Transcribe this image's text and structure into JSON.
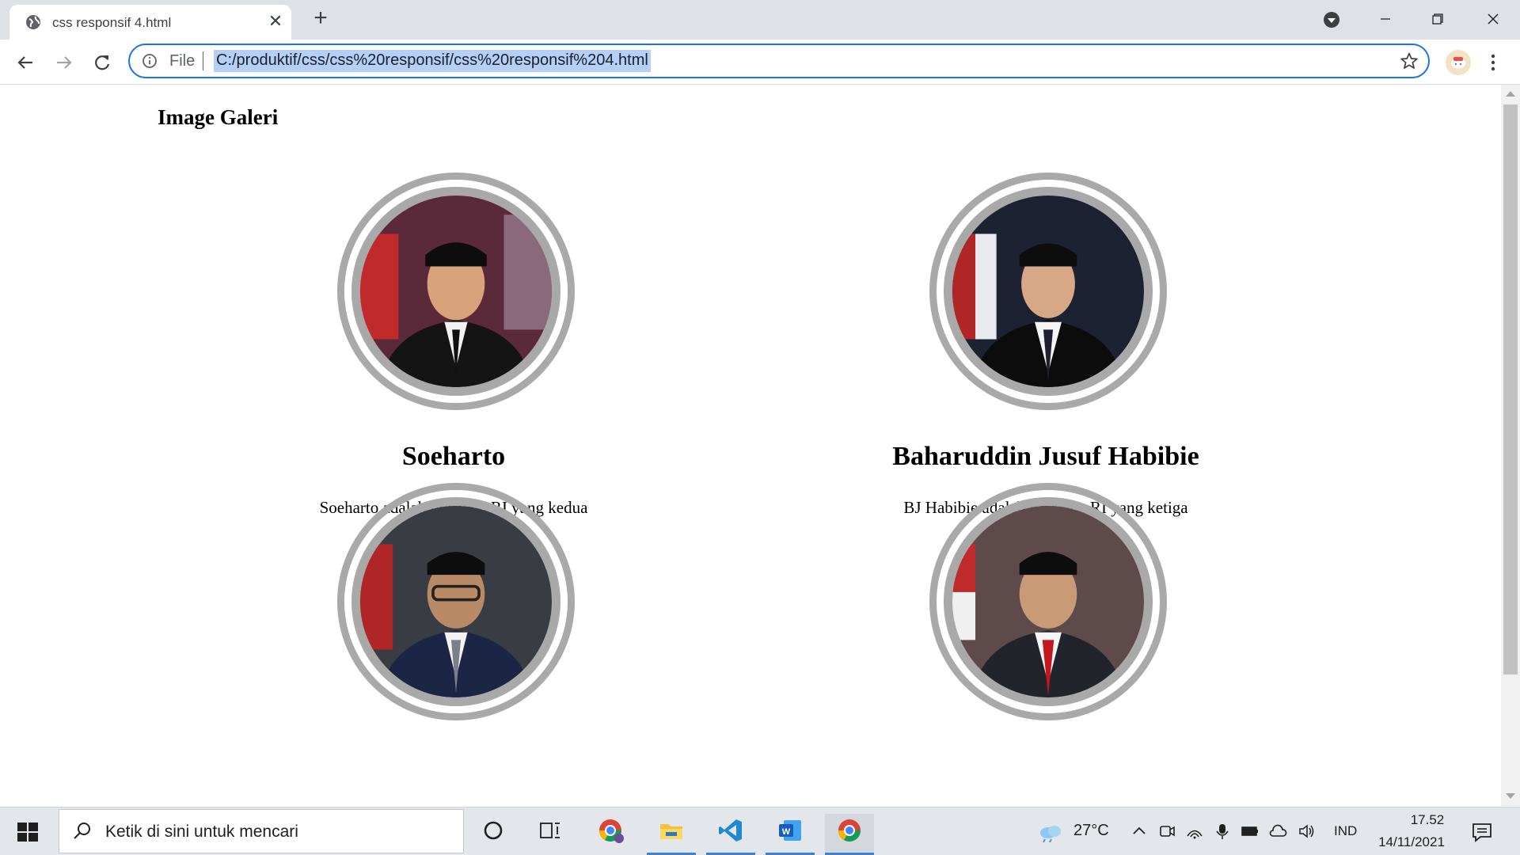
{
  "browser": {
    "tab_title": "css responsif 4.html",
    "address_scheme": "File",
    "address_url": "C:/produktif/css/css%20responsif/css%20responsif%204.html"
  },
  "page": {
    "heading": "Image Galeri",
    "cards": [
      {
        "name": "Soeharto",
        "caption": "Soeharto adalah presiden RI yang kedua"
      },
      {
        "name": "Baharuddin Jusuf Habibie",
        "caption": "BJ Habibie adalah presiden RI yang ketiga"
      },
      {
        "name": "",
        "caption": ""
      },
      {
        "name": "",
        "caption": ""
      }
    ]
  },
  "taskbar": {
    "search_placeholder": "Ketik di sini untuk mencari",
    "weather_temp": "27°C",
    "language": "IND",
    "time": "17.52",
    "date": "14/11/2021"
  },
  "colors": {
    "accent": "#1a73e8",
    "selection": "#b4cff8",
    "portrait_ring": "#a9a9a9"
  }
}
